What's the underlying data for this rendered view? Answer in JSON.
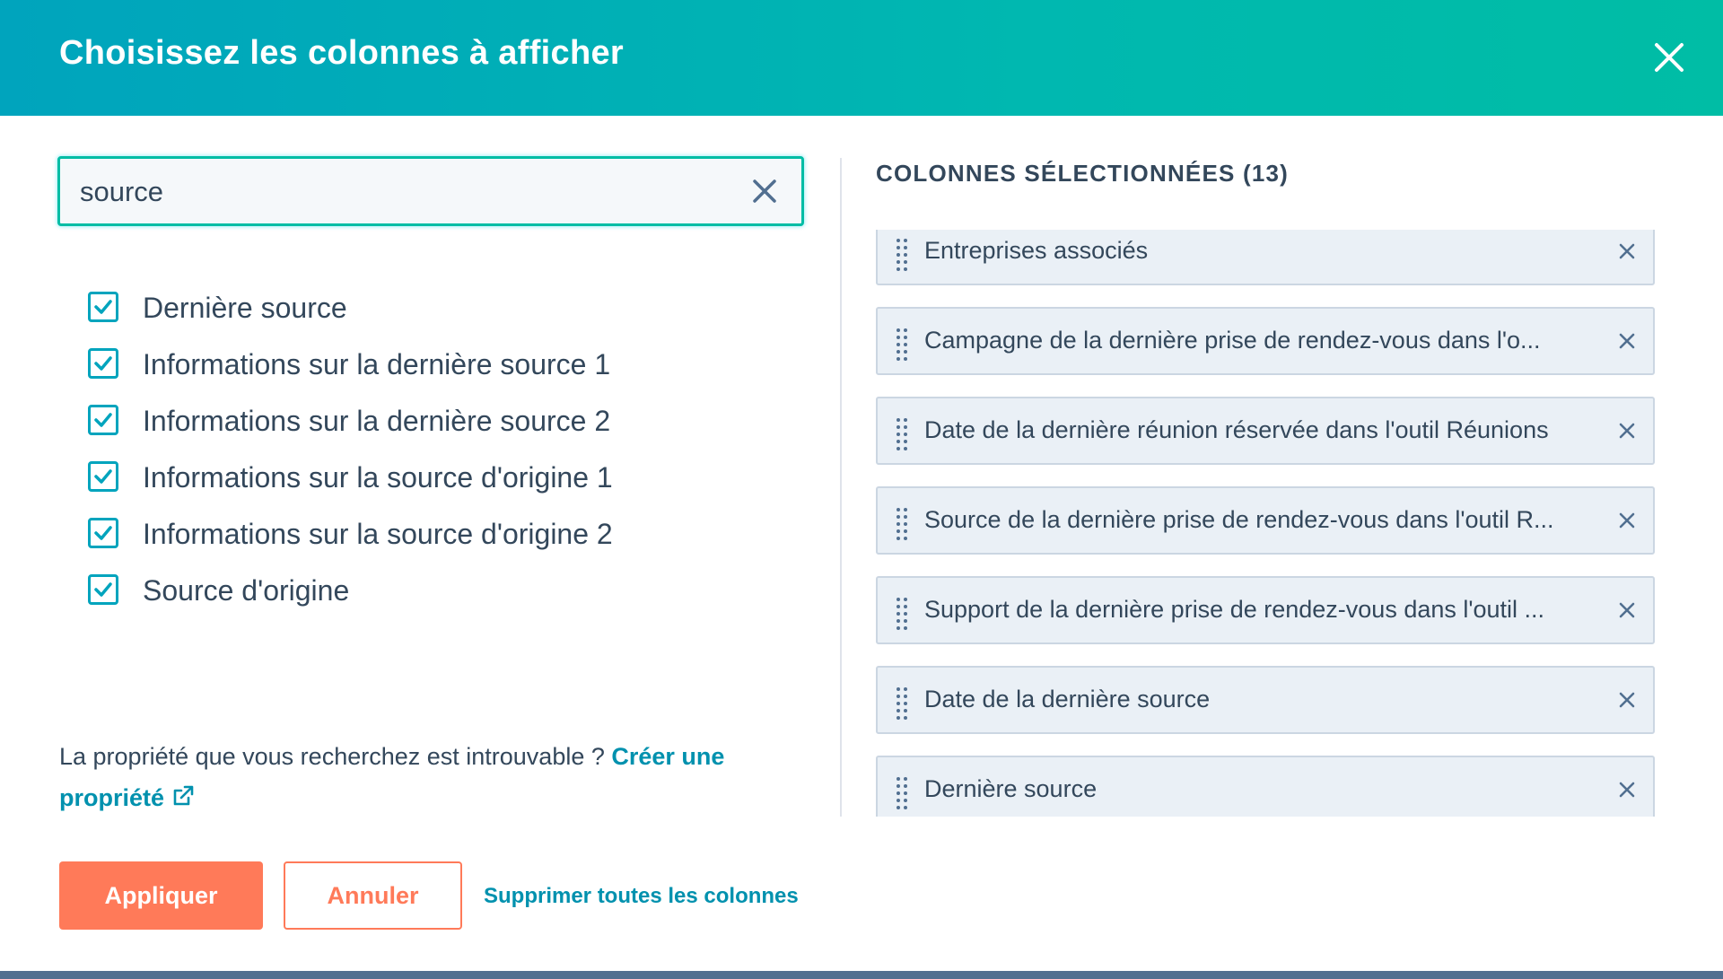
{
  "modal": {
    "title": "Choisissez les colonnes à afficher",
    "close_icon": "close-icon"
  },
  "search": {
    "value": "source",
    "clear_icon": "close-icon"
  },
  "options": [
    {
      "label": "Dernière source",
      "checked": true
    },
    {
      "label": "Informations sur la dernière source 1",
      "checked": true
    },
    {
      "label": "Informations sur la dernière source 2",
      "checked": true
    },
    {
      "label": "Informations sur la source d'origine 1",
      "checked": true
    },
    {
      "label": "Informations sur la source d'origine 2",
      "checked": true
    },
    {
      "label": "Source d'origine",
      "checked": true
    }
  ],
  "help": {
    "text": "La propriété que vous recherchez est introuvable ? ",
    "link_line1": "Créer une",
    "link_line2": "propriété",
    "link_icon": "external-link-icon"
  },
  "selected": {
    "heading": "COLONNES SÉLECTIONNÉES (13)",
    "items": [
      {
        "label": "Entreprises associés"
      },
      {
        "label": "Campagne de la dernière prise de rendez-vous dans l'o..."
      },
      {
        "label": "Date de la dernière réunion réservée dans l'outil Réunions"
      },
      {
        "label": "Source de la dernière prise de rendez-vous dans l'outil R..."
      },
      {
        "label": "Support de la dernière prise de rendez-vous dans l'outil ..."
      },
      {
        "label": "Date de la dernière source"
      },
      {
        "label": "Dernière source"
      }
    ]
  },
  "footer": {
    "apply_label": "Appliquer",
    "cancel_label": "Annuler",
    "remove_all_label": "Supprimer toutes les colonnes"
  },
  "colors": {
    "header_start": "#00a4bd",
    "header_end": "#00bda5",
    "primary": "#ff7a59",
    "link": "#0091ae",
    "text": "#33475b"
  }
}
